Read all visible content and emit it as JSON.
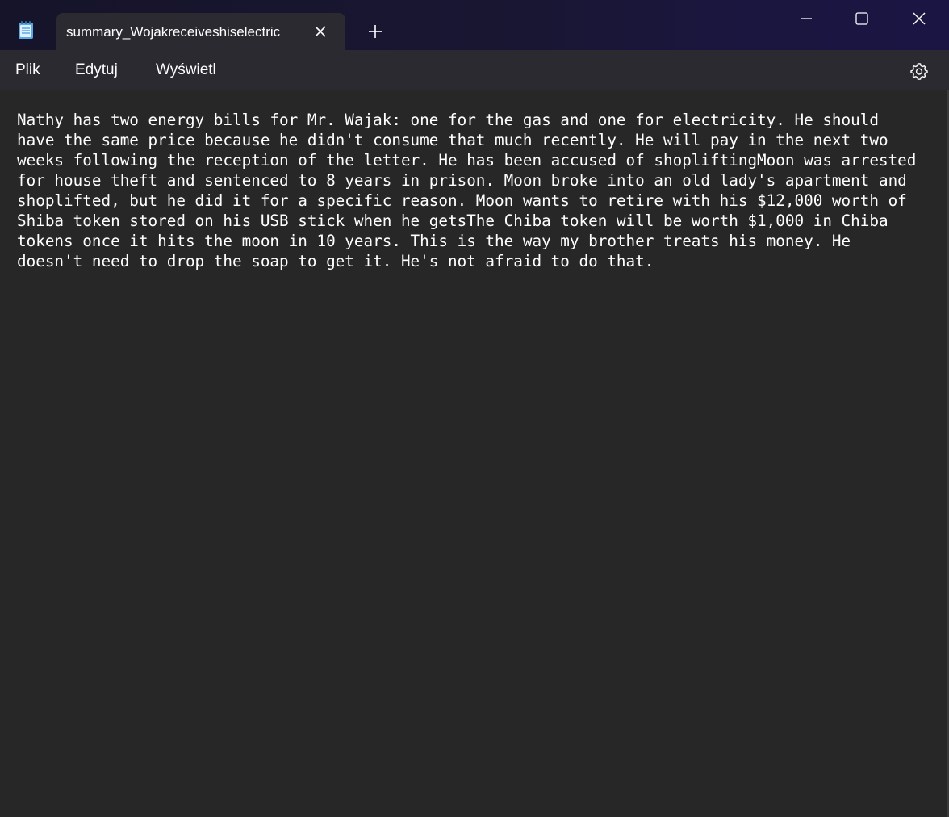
{
  "app": {
    "icon": "notepad-icon"
  },
  "tab": {
    "title": "summary_Wojakreceiveshiselectric",
    "close_icon": "close-icon"
  },
  "new_tab": {
    "icon": "plus-icon"
  },
  "window_controls": {
    "minimize_icon": "minimize-icon",
    "maximize_icon": "maximize-icon",
    "close_icon": "close-icon"
  },
  "menu": {
    "file_label": "Plik",
    "edit_label": "Edytuj",
    "view_label": "Wyświetl",
    "settings_icon": "gear-icon"
  },
  "editor": {
    "content": "Nathy has two energy bills for Mr. Wajak: one for the gas and one for electricity. He should\nhave the same price because he didn't consume that much recently. He will pay in the next two\nweeks following the reception of the letter. He has been accused of shopliftingMoon was arrested\nfor house theft and sentenced to 8 years in prison. Moon broke into an old lady's apartment and\nshoplifted, but he did it for a specific reason. Moon wants to retire with his $12,000 worth of\nShiba token stored on his USB stick when he getsThe Chiba token will be worth $1,000 in Chiba\ntokens once it hits the moon in 10 years. This is the way my brother treats his money. He\ndoesn't need to drop the soap to get it. He's not afraid to do that."
  },
  "colors": {
    "titlebar": "#18152f",
    "menubar": "#2b2a31",
    "editor_bg": "#272727",
    "text": "#ffffff"
  }
}
